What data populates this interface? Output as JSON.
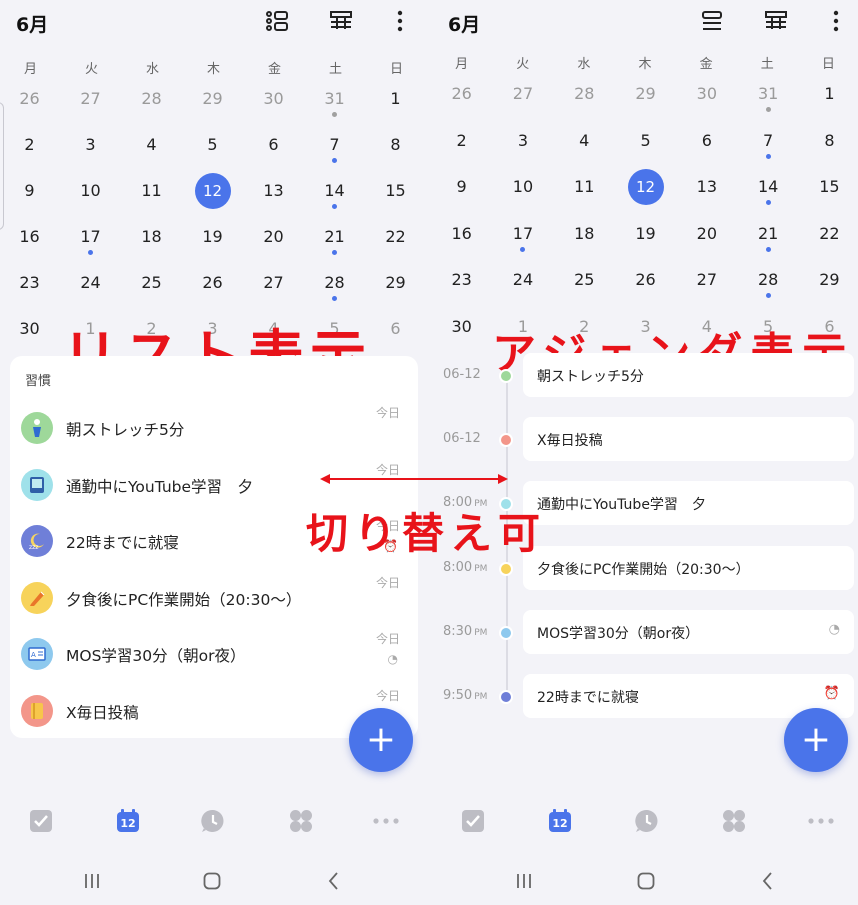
{
  "colors": {
    "accent": "#4a74ea",
    "annotation": "#e8131a",
    "background": "#f3f3f8",
    "card": "#ffffff"
  },
  "left": {
    "month": "6月",
    "header_icons": [
      "list-view-icon",
      "grid-view-icon",
      "more-vert-icon"
    ],
    "weekdays": [
      "月",
      "火",
      "水",
      "木",
      "金",
      "土",
      "日"
    ],
    "weeks": [
      [
        {
          "n": "26",
          "dim": true
        },
        {
          "n": "27",
          "dim": true
        },
        {
          "n": "28",
          "dim": true
        },
        {
          "n": "29",
          "dim": true
        },
        {
          "n": "30",
          "dim": true
        },
        {
          "n": "31",
          "dim": true,
          "dot": "grey"
        },
        {
          "n": "1"
        }
      ],
      [
        {
          "n": "2"
        },
        {
          "n": "3"
        },
        {
          "n": "4"
        },
        {
          "n": "5"
        },
        {
          "n": "6"
        },
        {
          "n": "7",
          "dot": "blue"
        },
        {
          "n": "8"
        }
      ],
      [
        {
          "n": "9"
        },
        {
          "n": "10"
        },
        {
          "n": "11"
        },
        {
          "n": "12",
          "today": true
        },
        {
          "n": "13"
        },
        {
          "n": "14",
          "dot": "blue"
        },
        {
          "n": "15"
        }
      ],
      [
        {
          "n": "16"
        },
        {
          "n": "17",
          "dot": "blue"
        },
        {
          "n": "18"
        },
        {
          "n": "19"
        },
        {
          "n": "20"
        },
        {
          "n": "21",
          "dot": "blue"
        },
        {
          "n": "22"
        }
      ],
      [
        {
          "n": "23"
        },
        {
          "n": "24"
        },
        {
          "n": "25"
        },
        {
          "n": "26"
        },
        {
          "n": "27"
        },
        {
          "n": "28",
          "dot": "blue"
        },
        {
          "n": "29"
        }
      ],
      [
        {
          "n": "30"
        },
        {
          "n": "1",
          "dim": true
        },
        {
          "n": "2",
          "dim": true
        },
        {
          "n": "3",
          "dim": true
        },
        {
          "n": "4",
          "dim": true
        },
        {
          "n": "5",
          "dim": true
        },
        {
          "n": "6",
          "dim": true
        }
      ]
    ],
    "annotation": "リスト表示",
    "section_title": "習慣",
    "habits": [
      {
        "name": "朝ストレッチ5分",
        "today": "今日",
        "icon": "stretch-icon",
        "icon_bg": "#9ed89a"
      },
      {
        "name": "通勤中にYouTube学習　夕",
        "today": "今日",
        "icon": "tablet-icon",
        "icon_bg": "#9fe1ea"
      },
      {
        "name": "22時までに就寝",
        "today": "今日",
        "sub": "⏰",
        "icon": "moon-icon",
        "icon_bg": "#6f7fd8"
      },
      {
        "name": "夕食後にPC作業開始（20:30〜）",
        "today": "今日",
        "icon": "pencil-icon",
        "icon_bg": "#f7d35b"
      },
      {
        "name": "MOS学習30分（朝or夜）",
        "today": "今日",
        "sub": "◔",
        "icon": "book-icon",
        "icon_bg": "#8ec9ee"
      },
      {
        "name": "X毎日投稿",
        "today": "今日",
        "icon": "notebook-icon",
        "icon_bg": "#f3968a"
      }
    ],
    "fab": "+"
  },
  "switch_annotation": "切り替え可",
  "right": {
    "month": "6月",
    "header_icons": [
      "agenda-view-icon",
      "grid-view-icon",
      "more-vert-icon"
    ],
    "weekdays": [
      "月",
      "火",
      "水",
      "木",
      "金",
      "土",
      "日"
    ],
    "weeks": [
      [
        {
          "n": "26",
          "dim": true
        },
        {
          "n": "27",
          "dim": true
        },
        {
          "n": "28",
          "dim": true
        },
        {
          "n": "29",
          "dim": true
        },
        {
          "n": "30",
          "dim": true
        },
        {
          "n": "31",
          "dim": true,
          "dot": "grey"
        },
        {
          "n": "1"
        }
      ],
      [
        {
          "n": "2"
        },
        {
          "n": "3"
        },
        {
          "n": "4"
        },
        {
          "n": "5"
        },
        {
          "n": "6"
        },
        {
          "n": "7",
          "dot": "blue"
        },
        {
          "n": "8"
        }
      ],
      [
        {
          "n": "9"
        },
        {
          "n": "10"
        },
        {
          "n": "11"
        },
        {
          "n": "12",
          "today": true
        },
        {
          "n": "13"
        },
        {
          "n": "14",
          "dot": "blue"
        },
        {
          "n": "15"
        }
      ],
      [
        {
          "n": "16"
        },
        {
          "n": "17",
          "dot": "blue"
        },
        {
          "n": "18"
        },
        {
          "n": "19"
        },
        {
          "n": "20"
        },
        {
          "n": "21",
          "dot": "blue"
        },
        {
          "n": "22"
        }
      ],
      [
        {
          "n": "23"
        },
        {
          "n": "24"
        },
        {
          "n": "25"
        },
        {
          "n": "26"
        },
        {
          "n": "27"
        },
        {
          "n": "28",
          "dot": "blue"
        },
        {
          "n": "29"
        }
      ],
      [
        {
          "n": "30"
        },
        {
          "n": "1",
          "dim": true
        },
        {
          "n": "2",
          "dim": true
        },
        {
          "n": "3",
          "dim": true
        },
        {
          "n": "4",
          "dim": true
        },
        {
          "n": "5",
          "dim": true
        },
        {
          "n": "6",
          "dim": true
        }
      ]
    ],
    "annotation": "アジェンダ表示",
    "agenda": [
      {
        "time": "06-12",
        "ampm": "",
        "title": "朝ストレッチ5分",
        "end": "",
        "dot_color": "#9ed89a"
      },
      {
        "time": "06-12",
        "ampm": "",
        "title": "X毎日投稿",
        "end": "",
        "dot_color": "#f3968a"
      },
      {
        "time": "8:00",
        "ampm": "PM",
        "title": "通勤中にYouTube学習　夕",
        "end": "",
        "dot_color": "#9fe1ea"
      },
      {
        "time": "8:00",
        "ampm": "PM",
        "title": "夕食後にPC作業開始（20:30〜）",
        "end": "",
        "dot_color": "#f7d35b"
      },
      {
        "time": "8:30",
        "ampm": "PM",
        "title": "MOS学習30分（朝or夜）",
        "end": "◔",
        "dot_color": "#8ec9ee"
      },
      {
        "time": "9:50",
        "ampm": "PM",
        "title": "22時までに就寝",
        "end": "⏰",
        "dot_color": "#6f7fd8"
      }
    ],
    "fab": "+"
  },
  "bottom_nav": [
    {
      "icon": "task-check-icon",
      "active": false
    },
    {
      "icon": "calendar-icon",
      "active": true,
      "label": "12"
    },
    {
      "icon": "clock-icon",
      "active": false
    },
    {
      "icon": "grid-apps-icon",
      "active": false
    },
    {
      "icon": "more-horiz-icon",
      "active": false
    }
  ],
  "system_nav": [
    "recent-apps-icon",
    "home-icon",
    "back-icon"
  ]
}
